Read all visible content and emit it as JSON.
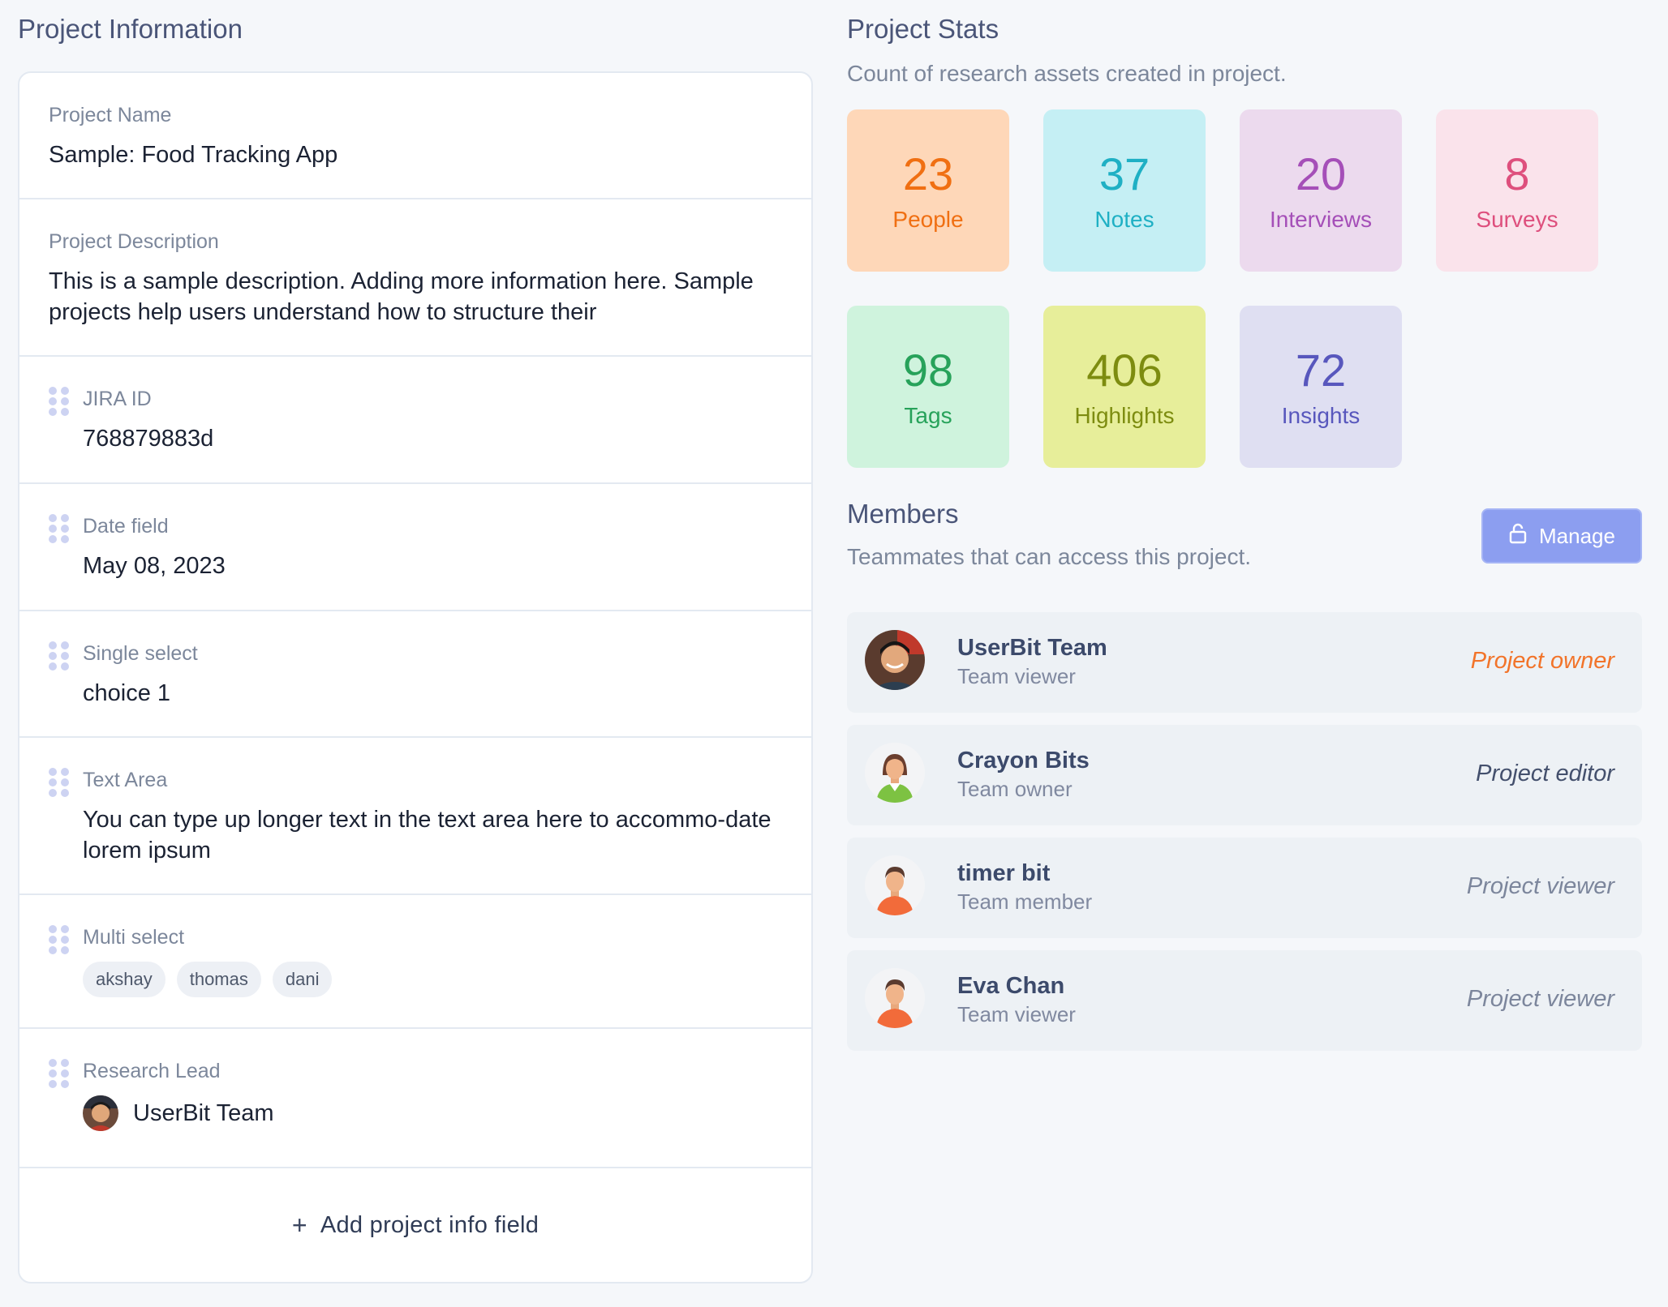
{
  "project_info": {
    "title": "Project Information",
    "fields": {
      "name_label": "Project Name",
      "name_value": "Sample: Food Tracking App",
      "desc_label": "Project Description",
      "desc_value": "This is a sample description. Adding more information here. Sample projects help users understand how to structure their",
      "jira_label": "JIRA ID",
      "jira_value": "768879883d",
      "date_label": "Date field",
      "date_value": "May 08, 2023",
      "single_label": "Single select",
      "single_value": "choice 1",
      "textarea_label": "Text Area",
      "textarea_value": "You can type up longer text in the text area here to accommo-date lorem ipsum",
      "multi_label": "Multi select",
      "multi_values": [
        "akshay",
        "thomas",
        "dani"
      ],
      "lead_label": "Research Lead",
      "lead_value": "UserBit Team"
    },
    "add_field_label": "Add project info field"
  },
  "project_stats": {
    "title": "Project Stats",
    "subtitle": "Count of research assets created in project.",
    "stats": [
      {
        "value": "23",
        "label": "People",
        "bg": "#fed7b8",
        "fg": "#f06f12"
      },
      {
        "value": "37",
        "label": "Notes",
        "bg": "#c5eff4",
        "fg": "#1fb0c4"
      },
      {
        "value": "20",
        "label": "Interviews",
        "bg": "#ecdaee",
        "fg": "#a54fb8"
      },
      {
        "value": "8",
        "label": "Surveys",
        "bg": "#fae3eb",
        "fg": "#de4f7d"
      },
      {
        "value": "98",
        "label": "Tags",
        "bg": "#cff3dd",
        "fg": "#27a25a"
      },
      {
        "value": "406",
        "label": "Highlights",
        "bg": "#e7ee9a",
        "fg": "#7d8c10"
      },
      {
        "value": "72",
        "label": "Insights",
        "bg": "#dfdff2",
        "fg": "#5857bd"
      }
    ]
  },
  "members": {
    "title": "Members",
    "subtitle": "Teammates that can access this project.",
    "manage_label": "Manage",
    "list": [
      {
        "name": "UserBit Team",
        "team_role": "Team viewer",
        "project_role": "Project owner",
        "role_color": "#f2742a",
        "avatar": "photo"
      },
      {
        "name": "Crayon Bits",
        "team_role": "Team owner",
        "project_role": "Project editor",
        "role_color": "#44506d",
        "avatar": "female"
      },
      {
        "name": "timer bit",
        "team_role": "Team member",
        "project_role": "Project viewer",
        "role_color": "#7c869c",
        "avatar": "male"
      },
      {
        "name": "Eva Chan",
        "team_role": "Team viewer",
        "project_role": "Project viewer",
        "role_color": "#7c869c",
        "avatar": "male"
      }
    ]
  }
}
